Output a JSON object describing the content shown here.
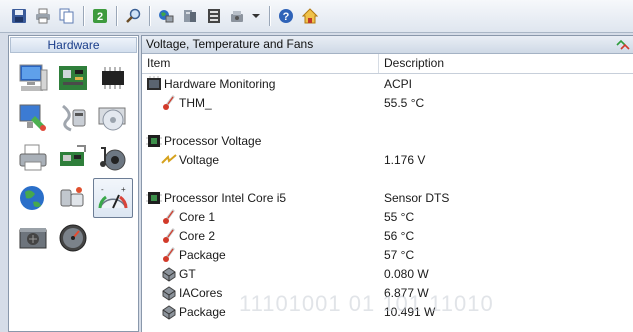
{
  "toolbar": {
    "buttons": [
      "save-icon",
      "print-icon",
      "copy-icon",
      "refresh-icon",
      "search-icon",
      "network-icon",
      "sensor-icon",
      "report-icon",
      "tools-icon",
      "help-icon",
      "home-icon"
    ]
  },
  "left_panel": {
    "title": "Hardware",
    "icons": [
      "computer-icon",
      "motherboard-icon",
      "cpu-chip-icon",
      "display-icon",
      "storage-icon",
      "optical-drive-icon",
      "printer-icon",
      "network-card-icon",
      "audio-icon",
      "internet-icon",
      "devices-icon",
      "sensor-gauge-icon",
      "power-supply-icon",
      "benchmark-icon"
    ],
    "selected": "sensor-gauge-icon"
  },
  "main": {
    "title": "Voltage, Temperature and Fans",
    "columns": {
      "item": "Item",
      "description": "Description"
    },
    "rows": [
      {
        "kind": "group",
        "icon": "monitoring-chip-icon",
        "item": "Hardware Monitoring",
        "desc": "ACPI"
      },
      {
        "kind": "sub",
        "icon": "thermometer-icon",
        "item": "THM_",
        "desc": "55.5 °C"
      },
      {
        "kind": "blank"
      },
      {
        "kind": "group",
        "icon": "processor-chip-icon",
        "item": "Processor Voltage",
        "desc": ""
      },
      {
        "kind": "sub",
        "icon": "voltage-icon",
        "item": "Voltage",
        "desc": "1.176 V"
      },
      {
        "kind": "blank"
      },
      {
        "kind": "group",
        "icon": "processor-chip-icon",
        "item": "Processor Intel Core i5",
        "desc": "Sensor DTS"
      },
      {
        "kind": "sub",
        "icon": "thermometer-icon",
        "item": "Core 1",
        "desc": "55 °C"
      },
      {
        "kind": "sub",
        "icon": "thermometer-icon",
        "item": "Core 2",
        "desc": "56 °C"
      },
      {
        "kind": "sub",
        "icon": "thermometer-icon",
        "item": "Package",
        "desc": "57 °C"
      },
      {
        "kind": "sub",
        "icon": "power-chip-icon",
        "item": "GT",
        "desc": "0.080 W"
      },
      {
        "kind": "sub",
        "icon": "power-chip-icon",
        "item": "IACores",
        "desc": "6.877 W"
      },
      {
        "kind": "sub",
        "icon": "power-chip-icon",
        "item": "Package",
        "desc": "10.491 W"
      }
    ]
  },
  "watermark": "11101001  01  101  11010"
}
